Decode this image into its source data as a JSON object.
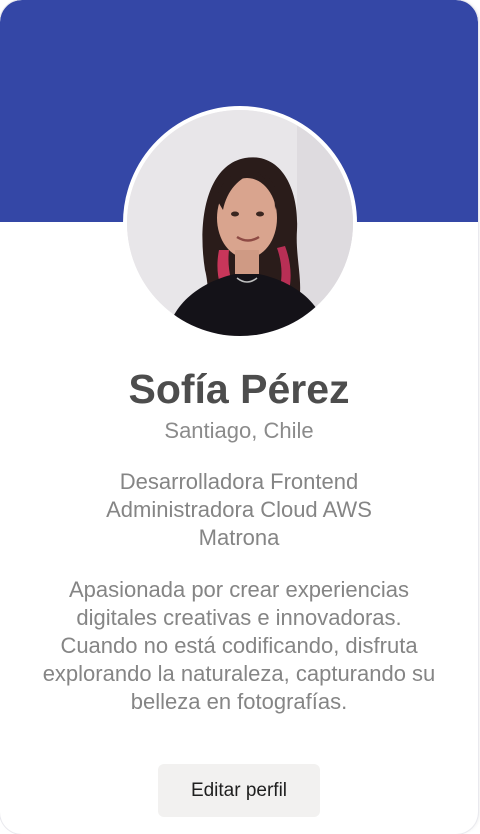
{
  "profile": {
    "name": "Sofía Pérez",
    "location": "Santiago, Chile",
    "roles": [
      "Desarrolladora Frontend",
      "Administradora Cloud AWS",
      "Matrona"
    ],
    "bio": "Apasionada por crear experiencias digitales creativas e innovadoras. Cuando no está codificando, disfruta explorando la naturaleza, capturando su belleza en fotografías.",
    "edit_button_label": "Editar perfil"
  },
  "colors": {
    "banner": "#3447a6",
    "name_text": "#4d4d4d",
    "secondary_text": "#858585",
    "button_bg": "#f2f1f0"
  }
}
